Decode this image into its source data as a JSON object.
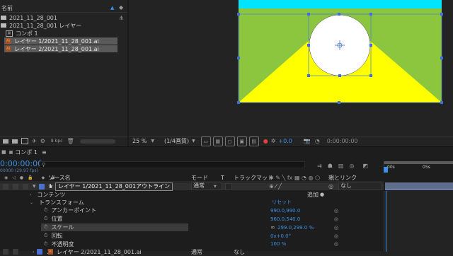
{
  "project": {
    "column_header": "名前",
    "items": [
      {
        "label": "2021_11_28_001",
        "type": "folder"
      },
      {
        "label": "2021_11_28_001 レイヤー",
        "type": "folder"
      },
      {
        "label": "コンポ 1",
        "type": "comp"
      },
      {
        "label": "レイヤー 1/2021_11_28_001.ai",
        "type": "ai"
      },
      {
        "label": "レイヤー 2/2021_11_28_001.ai",
        "type": "ai"
      }
    ],
    "bpc": "8 bpc"
  },
  "viewer": {
    "zoom": "25 %",
    "quality": "(1/4画質)",
    "exposure": "+0.0",
    "timecode": "0:00:00:00"
  },
  "timeline": {
    "comp_tab": "コンポ 1",
    "timecode": "0:00:00:00",
    "fps": "00000 (29.97 fps)",
    "search_placeholder": "",
    "columns": {
      "source": "ソース名",
      "mode": "モード",
      "t": "T",
      "trackmatte": "トラックマット",
      "parent": "親とリンク"
    },
    "ruler": {
      "t0": ":00s",
      "t1": "05s"
    },
    "layer1": {
      "num": "1",
      "name": "レイヤー 1/2021_11_28_001アウトライン",
      "mode": "通常",
      "parent": "なし"
    },
    "contents": {
      "label": "コンテンツ",
      "add": "追加"
    },
    "transform": {
      "label": "トランスフォーム",
      "reset": "リセット"
    },
    "props": [
      {
        "label": "アンカーポイント",
        "value": "990.0,990.0"
      },
      {
        "label": "位置",
        "value": "960.0,540.0"
      },
      {
        "label": "スケール",
        "link": "∞",
        "value": "299.0,299.0 %"
      },
      {
        "label": "回転",
        "value": "0x+0.0°"
      },
      {
        "label": "不透明度",
        "value": "100 %"
      }
    ],
    "layer2": {
      "num": "2",
      "name": "レイヤー 2/2021_11_28_001.ai",
      "mode": "通常",
      "trackmatte": "なし"
    }
  }
}
